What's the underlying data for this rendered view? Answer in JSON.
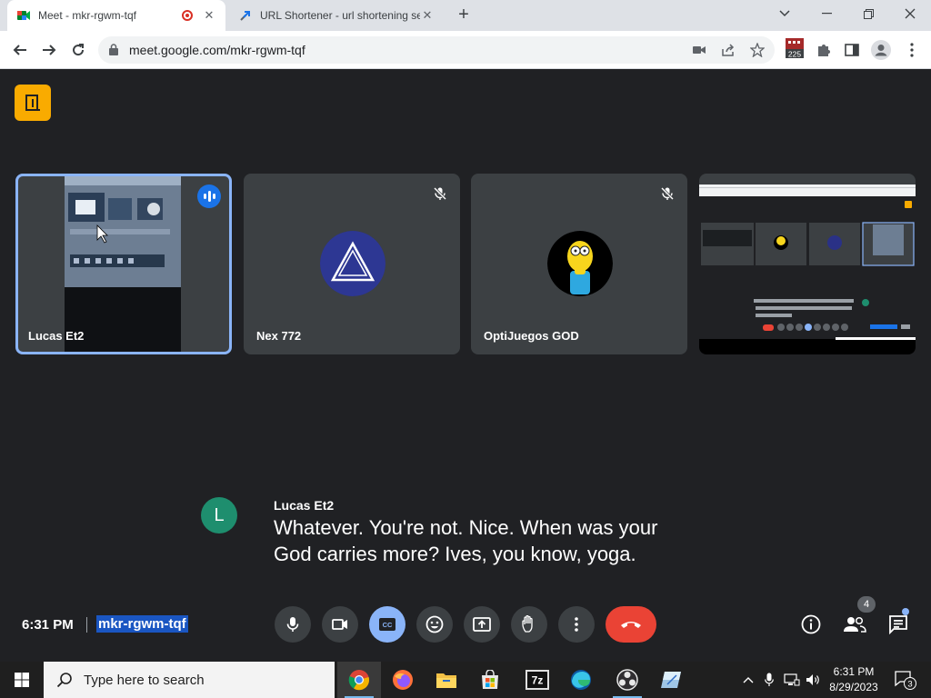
{
  "browser": {
    "tabs": [
      {
        "title": "Meet - mkr-rgwm-tqf",
        "active": true,
        "recording": true
      },
      {
        "title": "URL Shortener - url shortening se",
        "active": false
      }
    ],
    "new_tab_label": "+",
    "url": "meet.google.com/mkr-rgwm-tqf",
    "extension_badge": "225"
  },
  "meet": {
    "participants": [
      {
        "name": "Lucas Et2",
        "state": "speaking"
      },
      {
        "name": "Nex 772",
        "state": "muted"
      },
      {
        "name": "OptiJuegos GOD",
        "state": "muted"
      },
      {
        "name": "",
        "state": "presenting"
      }
    ],
    "caption": {
      "avatar_letter": "L",
      "speaker": "Lucas Et2",
      "lines": [
        "Whatever. You're not. Nice. When was your",
        "God carries more? Ives, you know, yoga."
      ]
    },
    "controls": {
      "time": "6:31 PM",
      "meeting_code": "mkr-rgwm-tqf",
      "people_count": "4",
      "captions_on": true
    }
  },
  "taskbar": {
    "search_placeholder": "Type here to search",
    "time": "6:31 PM",
    "date": "8/29/2023",
    "notification_count": "3"
  },
  "colors": {
    "meet_background": "#202124",
    "tile_background": "#3c4043",
    "active_tile_border": "#8ab4f8",
    "end_call": "#ea4335",
    "captions_button": "#8ab4f8",
    "meet_logo": "#f9ab00"
  }
}
